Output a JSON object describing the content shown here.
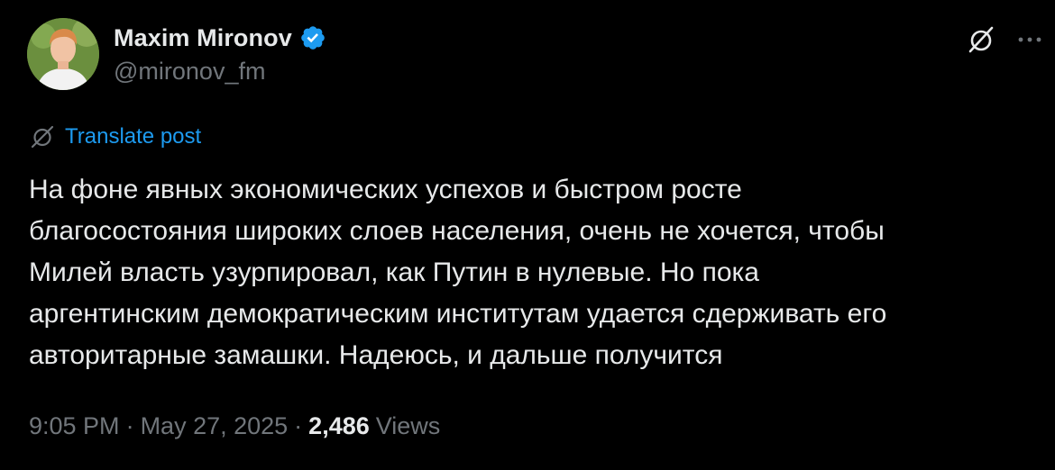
{
  "author": {
    "display_name": "Maxim Mironov",
    "handle": "@mironov_fm",
    "verified": true,
    "avatar_icon": "person-avatar"
  },
  "header_actions": {
    "grok_icon": "grok-icon",
    "more_icon": "more-dots-icon"
  },
  "translate": {
    "label": "Translate post",
    "icon": "grok-icon"
  },
  "post": {
    "lines": [
      "На фоне явных экономических успехов и быстром росте",
      "благосостояния широких слоев населения, очень не хочется, чтобы",
      "Милей власть узурпировал, как Путин в нулевые. Но пока",
      "аргентинским демократическим институтам удается сдерживать его",
      "авторитарные замашки. Надеюсь, и дальше получится"
    ]
  },
  "meta": {
    "time": "9:05 PM",
    "separator": "·",
    "date": "May 27, 2025",
    "views_count": "2,486",
    "views_label": "Views"
  },
  "colors": {
    "background": "#000000",
    "primary_text": "#e7e9ea",
    "secondary_text": "#71767b",
    "accent": "#1d9bf0"
  }
}
